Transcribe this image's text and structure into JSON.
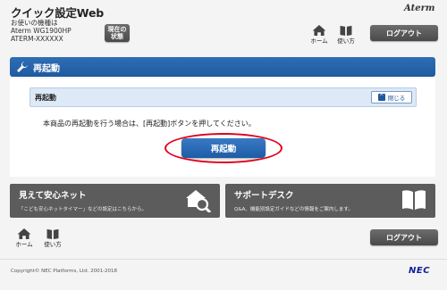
{
  "header": {
    "app_title": "クイック設定Web",
    "model_label": "お使いの機種は",
    "model_name": "Aterm WG1900HP",
    "model_serial": "ATERM-XXXXXX",
    "status_button": "現在の\n状態",
    "brand": "Aterm",
    "home_label": "ホーム",
    "manual_label": "使い方",
    "logout_label": "ログアウト"
  },
  "section": {
    "title": "再起動",
    "panel_title": "再起動",
    "collapse_label": "閉じる",
    "instruction": "本商品の再起動を行う場合は、[再起動]ボタンを押してください。",
    "reboot_button": "再起動"
  },
  "banners": {
    "safety_title": "見えて安心ネット",
    "safety_desc": "「こども安心ネットタイマー」などの設定はこちらから。",
    "support_title": "サポートデスク",
    "support_desc": "Q&A、機能別設定ガイドなどの情報をご案内します。"
  },
  "footer": {
    "home_label": "ホーム",
    "manual_label": "使い方",
    "logout_label": "ログアウト",
    "copyright": "Copyright© NEC Platforms, Ltd. 2001-2018",
    "nec_logo": "NEC"
  },
  "colors": {
    "accent_blue": "#1e5aa0",
    "banner_gray": "#5c5c5c",
    "highlight_red": "#e0001b"
  }
}
